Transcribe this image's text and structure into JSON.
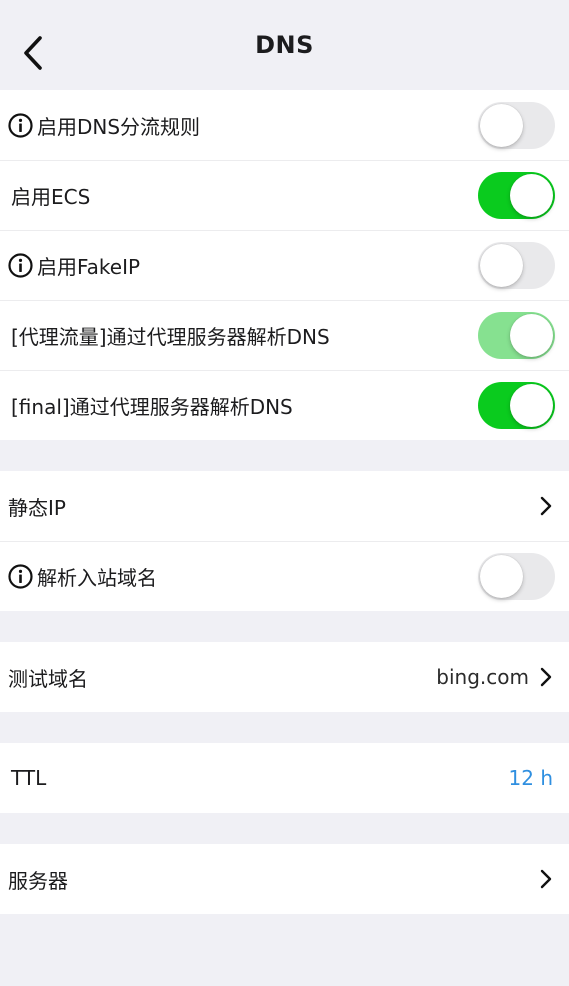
{
  "nav": {
    "title": "DNS"
  },
  "group1": {
    "dns_split": {
      "label": "启用DNS分流规则",
      "enabled": false
    },
    "ecs": {
      "label": "启用ECS",
      "enabled": true
    },
    "fakeip": {
      "label": "启用FakeIP",
      "enabled": false
    },
    "proxy_traffic": {
      "label": "[代理流量]通过代理服务器解析DNS",
      "enabled": true
    },
    "final_proxy": {
      "label": "[final]通过代理服务器解析DNS",
      "enabled": true
    }
  },
  "group2": {
    "static_ip": {
      "label": "静态IP"
    },
    "resolve_inbound": {
      "label": "解析入站域名",
      "enabled": false
    }
  },
  "group3": {
    "test_domain": {
      "label": "测试域名",
      "value": "bing.com"
    }
  },
  "group4": {
    "ttl": {
      "label": "TTL",
      "value": "12 h"
    }
  },
  "group5": {
    "servers": {
      "label": "服务器"
    }
  },
  "colors": {
    "toggle_on": "#0acb1e",
    "toggle_on_dim": "#86e190",
    "toggle_off": "#e9e9eb",
    "link_blue": "#2f8fe0"
  }
}
